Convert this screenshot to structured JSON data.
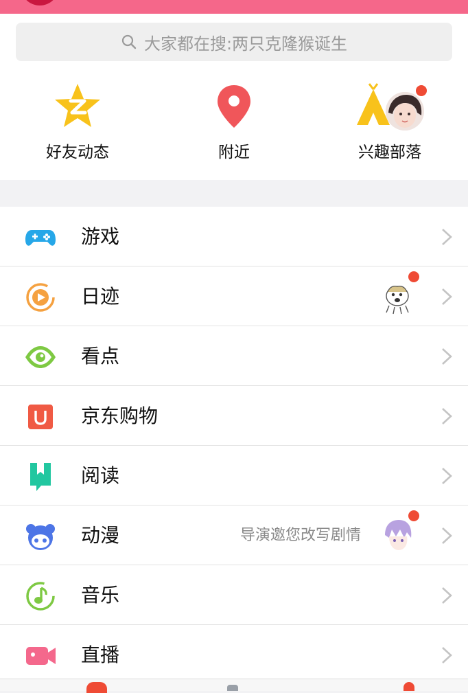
{
  "search": {
    "placeholder": "大家都在搜:两只克隆猴诞生"
  },
  "quick_entries": [
    {
      "label": "好友动态",
      "icon": "zone-star-icon"
    },
    {
      "label": "附近",
      "icon": "location-pin-icon"
    },
    {
      "label": "兴趣部落",
      "icon": "tribe-tent-icon"
    }
  ],
  "menu": [
    {
      "label": "游戏",
      "icon": "gamepad-icon"
    },
    {
      "label": "日迹",
      "icon": "play-circle-icon"
    },
    {
      "label": "看点",
      "icon": "eye-icon"
    },
    {
      "label": "京东购物",
      "icon": "jd-bag-icon"
    },
    {
      "label": "阅读",
      "icon": "bookmark-icon"
    },
    {
      "label": "动漫",
      "icon": "anime-face-icon",
      "note": "导演邀您改写剧情"
    },
    {
      "label": "音乐",
      "icon": "music-note-icon"
    },
    {
      "label": "直播",
      "icon": "video-camera-icon"
    }
  ],
  "colors": {
    "topbar": "#f5678a",
    "badge": "#ef4b35",
    "gamepad": "#26a7e8",
    "riji": "#f5a140",
    "kandian": "#7ec943",
    "jd": "#f05a44",
    "read": "#22c7a0",
    "anime": "#4d75e6",
    "music": "#7ec943",
    "live": "#f4688c"
  }
}
